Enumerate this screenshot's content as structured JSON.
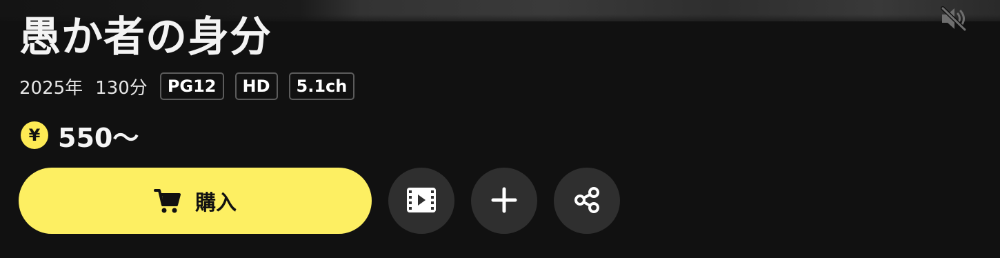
{
  "title": "愚か者の身分",
  "meta": {
    "year": "2025年",
    "duration": "130分",
    "badges": [
      "PG12",
      "HD",
      "5.1ch"
    ]
  },
  "price": {
    "symbol": "¥",
    "value": "550〜"
  },
  "actions": {
    "buy_label": "購入",
    "buy_icon": "cart-icon",
    "trailer_icon": "film-play-icon",
    "add_icon": "plus-icon",
    "share_icon": "share-icon",
    "mute_icon": "speaker-muted-icon"
  },
  "colors": {
    "background": "#111111",
    "accent_yellow": "#fdef62",
    "coin_yellow": "#fdea54",
    "round_button": "#2f2f2f"
  }
}
